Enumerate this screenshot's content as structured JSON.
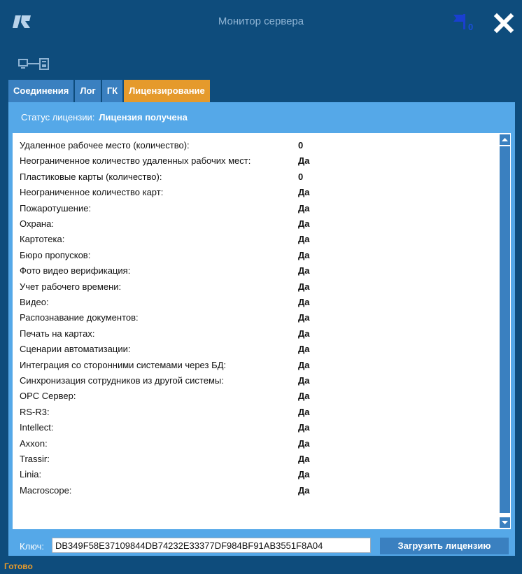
{
  "window": {
    "title": "Монитор сервера",
    "notification_count": "0",
    "icons": [
      "app-logo-icon",
      "flag-icon",
      "close-icon",
      "server-connection-icon"
    ]
  },
  "tabs": [
    {
      "label": "Соединения",
      "active": false
    },
    {
      "label": "Лог",
      "active": false
    },
    {
      "label": "ГК",
      "active": false
    },
    {
      "label": "Лицензирование",
      "active": true
    }
  ],
  "license": {
    "status_label": "Статус лицензии:",
    "status_value": "Лицензия получена",
    "items": [
      {
        "label": "Удаленное рабочее место (количество):",
        "value": "0"
      },
      {
        "label": "Неограниченное количество удаленных рабочих мест:",
        "value": "Да"
      },
      {
        "label": "Пластиковые карты (количество):",
        "value": "0"
      },
      {
        "label": "Неограниченное количество карт:",
        "value": "Да"
      },
      {
        "label": "Пожаротушение:",
        "value": "Да"
      },
      {
        "label": "Охрана:",
        "value": "Да"
      },
      {
        "label": "Картотека:",
        "value": "Да"
      },
      {
        "label": "Бюро пропусков:",
        "value": "Да"
      },
      {
        "label": "Фото видео верификация:",
        "value": "Да"
      },
      {
        "label": "Учет рабочего времени:",
        "value": "Да"
      },
      {
        "label": "Видео:",
        "value": "Да"
      },
      {
        "label": "Распознавание документов:",
        "value": "Да"
      },
      {
        "label": "Печать на картах:",
        "value": "Да"
      },
      {
        "label": "Сценарии автоматизации:",
        "value": "Да"
      },
      {
        "label": "Интеграция со сторонними системами через БД:",
        "value": "Да"
      },
      {
        "label": "Синхронизация сотрудников из другой системы:",
        "value": "Да"
      },
      {
        "label": "OPC Сервер:",
        "value": "Да"
      },
      {
        "label": "RS-R3:",
        "value": "Да"
      },
      {
        "label": "Intellect:",
        "value": "Да"
      },
      {
        "label": "Axxon:",
        "value": "Да"
      },
      {
        "label": "Trassir:",
        "value": "Да"
      },
      {
        "label": "Linia:",
        "value": "Да"
      },
      {
        "label": "Macroscope:",
        "value": "Да"
      }
    ],
    "key_label": "Ключ:",
    "key_value": "DB349F58E37109844DB74232E33377DF984BF91AB3551F8A04",
    "load_button": "Загрузить лицензию"
  },
  "footer_status": "Готово",
  "colors": {
    "background": "#0e4c7c",
    "panel": "#55a8e8",
    "tab": "#3a80c0",
    "tab_active": "#e59a2c",
    "footer_text": "#e59a2c"
  }
}
